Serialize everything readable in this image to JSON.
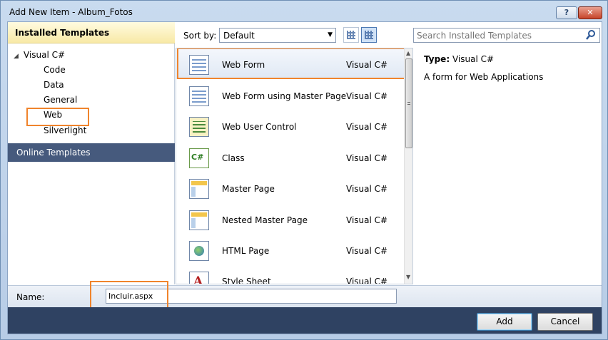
{
  "window": {
    "title": "Add New Item - Album_Fotos",
    "help_label": "?",
    "close_label": "✕"
  },
  "left": {
    "installed_header": "Installed Templates",
    "tree_root": "Visual C#",
    "tree_items": [
      "Code",
      "Data",
      "General",
      "Web",
      "Silverlight"
    ],
    "selected_category": "Web",
    "online_templates": "Online Templates"
  },
  "toolbar": {
    "sort_label": "Sort by:",
    "sort_value": "Default",
    "search_placeholder": "Search Installed Templates"
  },
  "templates": [
    {
      "name": "Web Form",
      "lang": "Visual C#",
      "icon": "web-form-icon"
    },
    {
      "name": "Web Form using Master Page",
      "lang": "Visual C#",
      "icon": "web-form-master-icon"
    },
    {
      "name": "Web User Control",
      "lang": "Visual C#",
      "icon": "user-control-icon"
    },
    {
      "name": "Class",
      "lang": "Visual C#",
      "icon": "csharp-class-icon"
    },
    {
      "name": "Master Page",
      "lang": "Visual C#",
      "icon": "master-page-icon"
    },
    {
      "name": "Nested Master Page",
      "lang": "Visual C#",
      "icon": "nested-master-page-icon"
    },
    {
      "name": "HTML Page",
      "lang": "Visual C#",
      "icon": "html-page-icon"
    },
    {
      "name": "Style Sheet",
      "lang": "Visual C#",
      "icon": "style-sheet-icon"
    }
  ],
  "selected_template": "Web Form",
  "details": {
    "type_label": "Type:",
    "type_value": "Visual C#",
    "description": "A form for Web Applications"
  },
  "name_row": {
    "label": "Name:",
    "value": "Incluir.aspx"
  },
  "buttons": {
    "add": "Add",
    "cancel": "Cancel"
  },
  "colors": {
    "highlight_outline": "#f0842c",
    "online_templates_bg": "#465a7d",
    "bottom_bar_bg": "#2f4262",
    "installed_header_bg": "#f8e9a6"
  }
}
